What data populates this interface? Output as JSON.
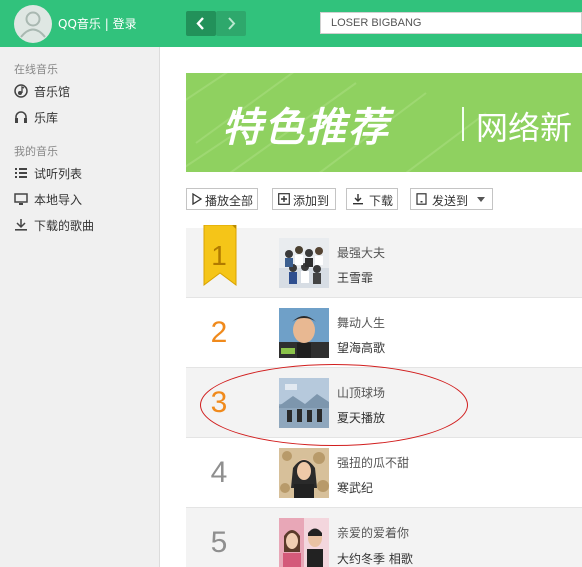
{
  "header": {
    "app_title": "QQ音乐 |  登录",
    "search_text": "LOSER BIGBANG",
    "avatar_icon": "user-avatar-icon",
    "back_icon": "chevron-left-icon",
    "forward_icon": "chevron-right-icon",
    "accent": "#31c27c"
  },
  "sidebar": {
    "online_section": "在线音乐",
    "my_section": "我的音乐",
    "items": [
      {
        "label": "音乐馆",
        "icon": "music-hall-icon"
      },
      {
        "label": "乐库",
        "icon": "headphones-icon"
      },
      {
        "label": "试听列表",
        "icon": "list-icon"
      },
      {
        "label": "本地导入",
        "icon": "monitor-icon"
      },
      {
        "label": "下载的歌曲",
        "icon": "download-icon"
      }
    ]
  },
  "banner": {
    "title": "特色推荐",
    "subtitle": "网络新",
    "color": "#8fd160"
  },
  "toolbar": {
    "play_all": "播放全部",
    "add_to": "添加到",
    "download": "下载",
    "send_to": "发送到"
  },
  "songs": [
    {
      "rank": "1",
      "title": "最强大夫",
      "artist": "王雪霏"
    },
    {
      "rank": "2",
      "title": "舞动人生",
      "artist": "望海高歌"
    },
    {
      "rank": "3",
      "title": "山顶球场",
      "artist": "夏天播放"
    },
    {
      "rank": "4",
      "title": "强扭的瓜不甜",
      "artist": "寒武纪"
    },
    {
      "rank": "5",
      "title": "亲爱的爱着你",
      "artist": "大约冬季 相歌"
    }
  ],
  "rank_colors": {
    "top": "#f08a1c",
    "rest": "#8f8f8f",
    "badge": "#f5c518"
  },
  "annotation_color": "#d11d1d"
}
